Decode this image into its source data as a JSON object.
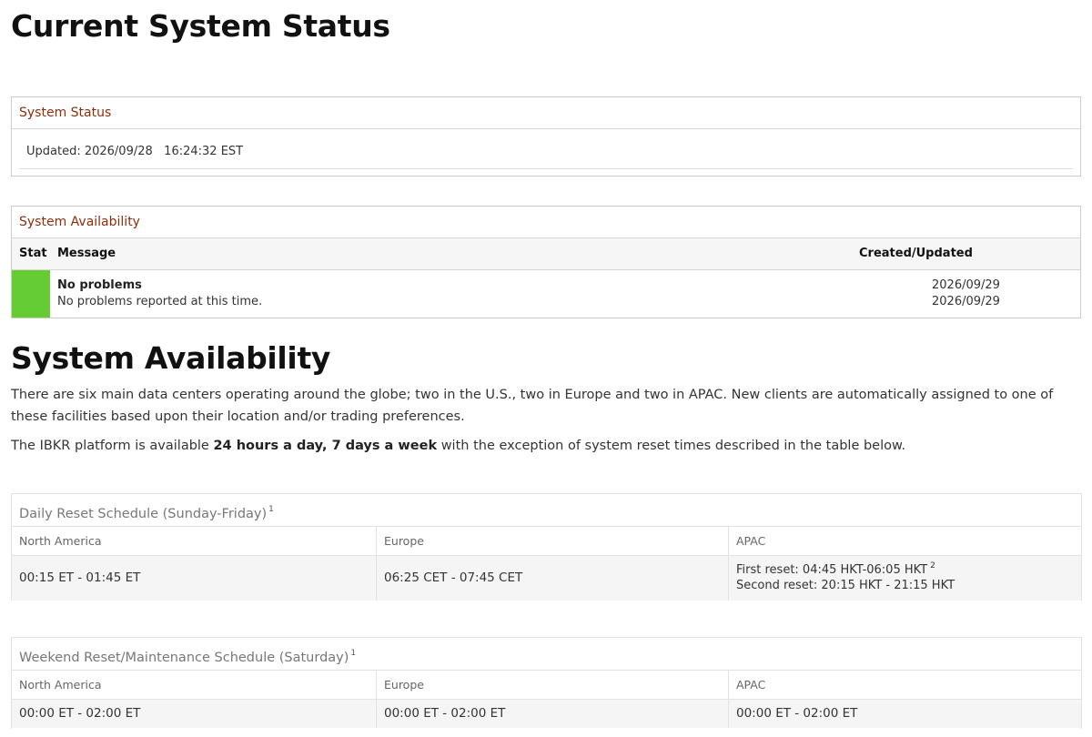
{
  "page": {
    "title": "Current System Status"
  },
  "system_status": {
    "heading": "System Status",
    "updated": "Updated: 2026/09/28   16:24:32 EST"
  },
  "system_availability_panel": {
    "heading": "System Availability",
    "columns": {
      "stat": "Stat",
      "message": "Message",
      "created": "Created/Updated"
    },
    "rows": [
      {
        "status_color": "#66cc33",
        "title": "No problems",
        "body": "No problems reported at this time.",
        "created": "2026/09/29",
        "updated": "2026/09/29"
      }
    ]
  },
  "availability_section": {
    "title": "System Availability",
    "para1": "There are six main data centers operating around the globe; two in the U.S., two in Europe and two in APAC. New clients are automatically assigned to one of these facilities based upon their location and/or trading preferences.",
    "para2_before": "The IBKR platform is available ",
    "para2_bold": "24 hours a day, 7 days a week",
    "para2_after": " with the exception of system reset times described in the table below."
  },
  "daily_schedule": {
    "title": "Daily Reset Schedule (Sunday-Friday)",
    "footnote": "1",
    "columns": [
      "North America",
      "Europe",
      "APAC"
    ],
    "north_america": "00:15 ET - 01:45 ET",
    "europe": "06:25 CET - 07:45 CET",
    "apac_first": "First reset: 04:45 HKT-06:05 HKT",
    "apac_first_footnote": "2",
    "apac_second": "Second reset: 20:15 HKT - 21:15 HKT"
  },
  "weekend_schedule": {
    "title": "Weekend Reset/Maintenance Schedule (Saturday)",
    "footnote": "1",
    "columns": [
      "North America",
      "Europe",
      "APAC"
    ],
    "north_america": "00:00 ET - 02:00 ET",
    "europe": "00:00 ET - 02:00 ET",
    "apac": "00:00 ET - 02:00 ET"
  },
  "colors": {
    "panel_heading": "#8b2e0c",
    "status_ok": "#66cc33"
  }
}
